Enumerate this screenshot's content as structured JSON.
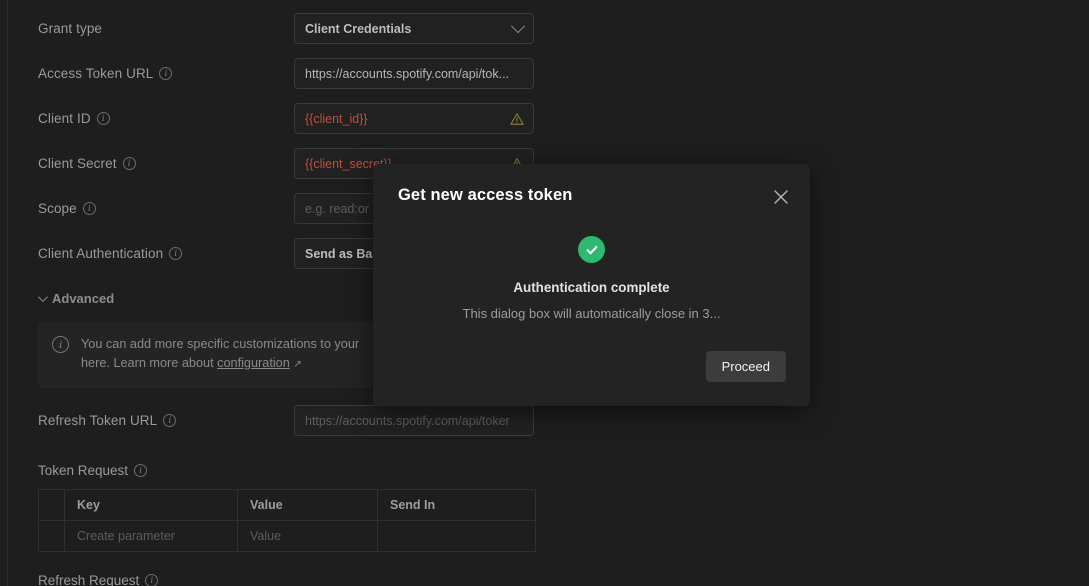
{
  "form": {
    "rows": [
      {
        "label": "Grant type",
        "has_info": false,
        "control": "select",
        "value": "Client Credentials"
      },
      {
        "label": "Access Token URL",
        "has_info": true,
        "control": "input",
        "value": "https://accounts.spotify.com/api/tok..."
      },
      {
        "label": "Client ID",
        "has_info": true,
        "control": "input",
        "value": "{{client_id}}",
        "state": "warning"
      },
      {
        "label": "Client Secret",
        "has_info": true,
        "control": "input",
        "value": "{{client_secret}}",
        "state": "warning"
      },
      {
        "label": "Scope",
        "has_info": true,
        "control": "input",
        "placeholder": "e.g. read:or"
      },
      {
        "label": "Client Authentication",
        "has_info": true,
        "control": "select-text",
        "value": "Send as Basi"
      }
    ]
  },
  "advanced": {
    "label": "Advanced",
    "expanded": true,
    "note": {
      "text_before_link": "You can add more specific customizations to your ",
      "text_wrapped": "here. Learn more about ",
      "link_label": "configuration",
      "external_arrow": "↗"
    }
  },
  "refresh": {
    "label": "Refresh Token URL",
    "placeholder": "https://accounts.spotify.com/api/toker"
  },
  "token_request": {
    "label": "Token Request",
    "columns": [
      "",
      "Key",
      "Value",
      "Send In"
    ],
    "rows": [
      {
        "key_placeholder": "Create parameter",
        "value_placeholder": "Value",
        "send_in": ""
      }
    ]
  },
  "refresh_request": {
    "label": "Refresh Request"
  },
  "dialog": {
    "title": "Get new access token",
    "close_label": "×",
    "status_icon": "success-check",
    "heading": "Authentication complete",
    "message": "This dialog box will automatically close in 3...",
    "primary_button": "Proceed"
  },
  "colors": {
    "page_background": "#1e1e1e",
    "panel_background": "#242424",
    "dialog_background": "#232323",
    "field_border": "#3a3a3a",
    "success_green": "#2eb872",
    "warning_text": "#c0503f",
    "warning_icon": "#8a7a3a",
    "button_background": "#3c3c3c"
  }
}
